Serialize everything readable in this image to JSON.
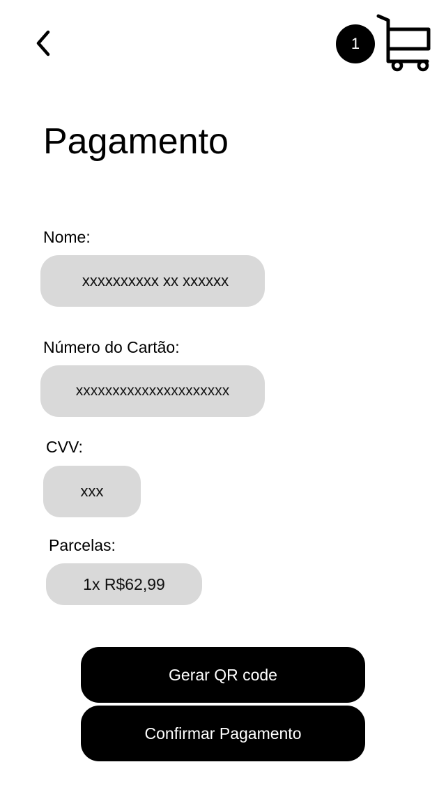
{
  "header": {
    "back_icon": "chevron-left-icon",
    "cart_icon": "shopping-cart-icon",
    "cart_count": "1"
  },
  "page": {
    "title": "Pagamento"
  },
  "form": {
    "name": {
      "label": "Nome:",
      "value": "xxxxxxxxxx xx xxxxxx"
    },
    "card_number": {
      "label": "Número do Cartão:",
      "value": "xxxxxxxxxxxxxxxxxxxxx"
    },
    "cvv": {
      "label": "CVV:",
      "value": "xxx"
    },
    "installments": {
      "label": "Parcelas:",
      "value": "1x R$62,99"
    }
  },
  "actions": {
    "qr_code_label": "Gerar QR code",
    "confirm_label": "Confirmar Pagamento"
  },
  "colors": {
    "field_bg": "#d9d9d9",
    "button_bg": "#000000",
    "button_text": "#ffffff"
  }
}
